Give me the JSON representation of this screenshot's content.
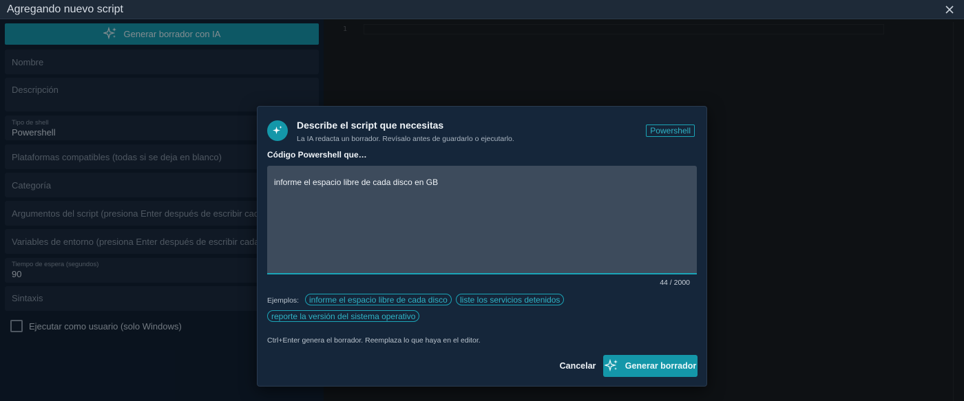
{
  "window": {
    "title": "Agregando nuevo script",
    "close_icon": "close-icon"
  },
  "form": {
    "ai_button_label": "Generar borrador con IA",
    "name_placeholder": "Nombre",
    "description_placeholder": "Descripción",
    "shell_type": {
      "label": "Tipo de shell",
      "value": "Powershell"
    },
    "platforms_placeholder": "Plataformas compatibles (todas si se deja en blanco)",
    "category_placeholder": "Categoría",
    "args_placeholder": "Argumentos del script (presiona Enter después de escribir cada ar",
    "env_placeholder": "Variables de entorno (presiona Enter después de escribir cada par",
    "timeout": {
      "label": "Tiempo de espera (segundos)",
      "value": "90"
    },
    "syntax_placeholder": "Sintaxis",
    "run_as_user_label": "Ejecutar como usuario (solo Windows)",
    "run_as_user_checked": false
  },
  "editor": {
    "line_numbers": [
      "1"
    ]
  },
  "dialog": {
    "title": "Describe el script que necesitas",
    "subtitle": "La IA redacta un borrador. Revísalo antes de guardarlo o ejecutarlo.",
    "shell_chip": "Powershell",
    "prompt_label": "Código Powershell que…",
    "prompt_value": "informe el espacio libre de cada disco en GB",
    "counter": "44 / 2000",
    "examples_label": "Ejemplos:",
    "examples": [
      "informe el espacio libre de cada disco",
      "liste los servicios detenidos",
      "reporte la versión del sistema operativo"
    ],
    "hint": "Ctrl+Enter genera el borrador. Reemplaza lo que haya en el editor.",
    "cancel_label": "Cancelar",
    "generate_label": "Generar borrador"
  },
  "colors": {
    "accent": "#1497a9",
    "accent_text": "#2fb3c6",
    "background": "#0d1826",
    "dialog_background": "#15263a"
  }
}
